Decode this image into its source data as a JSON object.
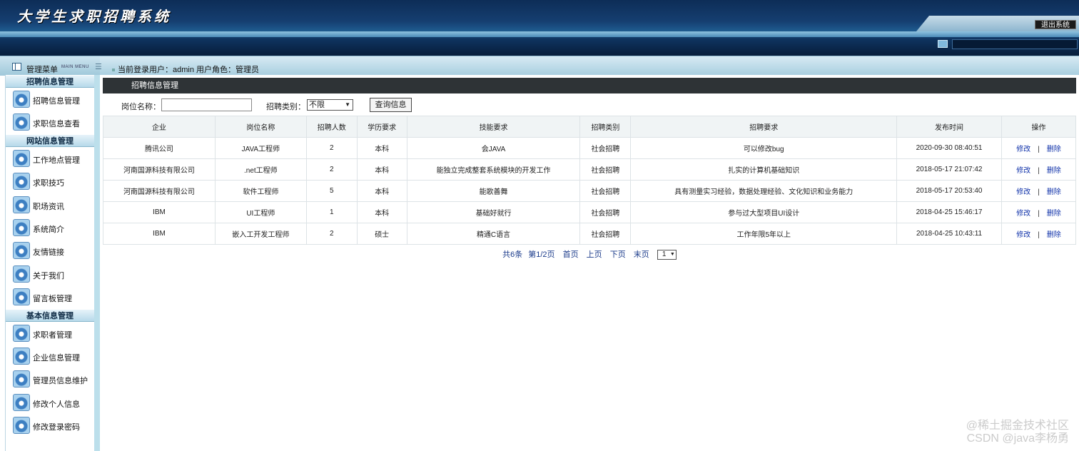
{
  "header": {
    "system_title": "大学生求职招聘系统",
    "logout_label": "退出系统"
  },
  "strip": {
    "menu_title": "管理菜单",
    "menu_title_en": "MAIN MENU",
    "current_user_text": "当前登录用户：admin  用户角色：管理员"
  },
  "sidebar": {
    "sections": [
      {
        "title": "招聘信息管理",
        "items": [
          "招聘信息管理",
          "求职信息查看"
        ]
      },
      {
        "title": "网站信息管理",
        "items": [
          "工作地点管理",
          "求职技巧",
          "职场资讯",
          "系统简介",
          "友情链接",
          "关于我们",
          "留言板管理"
        ]
      },
      {
        "title": "基本信息管理",
        "items": [
          "求职者管理",
          "企业信息管理",
          "管理员信息维护",
          "修改个人信息",
          "修改登录密码"
        ]
      }
    ]
  },
  "panel": {
    "title": "招聘信息管理",
    "search": {
      "position_label": "岗位名称：",
      "position_value": "",
      "type_label": "招聘类别：",
      "type_selected": "不限",
      "query_button": "查询信息"
    }
  },
  "table": {
    "columns": [
      "企业",
      "岗位名称",
      "招聘人数",
      "学历要求",
      "技能要求",
      "招聘类别",
      "招聘要求",
      "发布时间",
      "操作"
    ],
    "rows": [
      [
        "腾讯公司",
        "JAVA工程师",
        "2",
        "本科",
        "会JAVA",
        "社会招聘",
        "可以修改bug",
        "2020-09-30 08:40:51"
      ],
      [
        "河南国源科技有限公司",
        ".net工程师",
        "2",
        "本科",
        "能独立完成整套系统模块的开发工作",
        "社会招聘",
        "扎实的计算机基础知识",
        "2018-05-17 21:07:42"
      ],
      [
        "河南国源科技有限公司",
        "软件工程师",
        "5",
        "本科",
        "能歌善舞",
        "社会招聘",
        "具有测量实习经验，数据处理经验、文化知识和业务能力",
        "2018-05-17 20:53:40"
      ],
      [
        "IBM",
        "UI工程师",
        "1",
        "本科",
        "基础好就行",
        "社会招聘",
        "参与过大型项目UI设计",
        "2018-04-25 15:46:17"
      ],
      [
        "IBM",
        "嵌入工开发工程师",
        "2",
        "硕士",
        "精通C语言",
        "社会招聘",
        "工作年限5年以上",
        "2018-04-25 10:43:11"
      ]
    ],
    "edit_label": "修改",
    "separator": "|",
    "delete_label": "删除"
  },
  "pager": {
    "total_text": "共6条",
    "page_text": "第1/2页",
    "first_label": "首页",
    "prev_label": "上页",
    "next_label": "下页",
    "last_label": "末页",
    "page_select": "1"
  },
  "watermark": {
    "line1": "@稀土掘金技术社区",
    "line2": "CSDN @java李杨勇"
  }
}
